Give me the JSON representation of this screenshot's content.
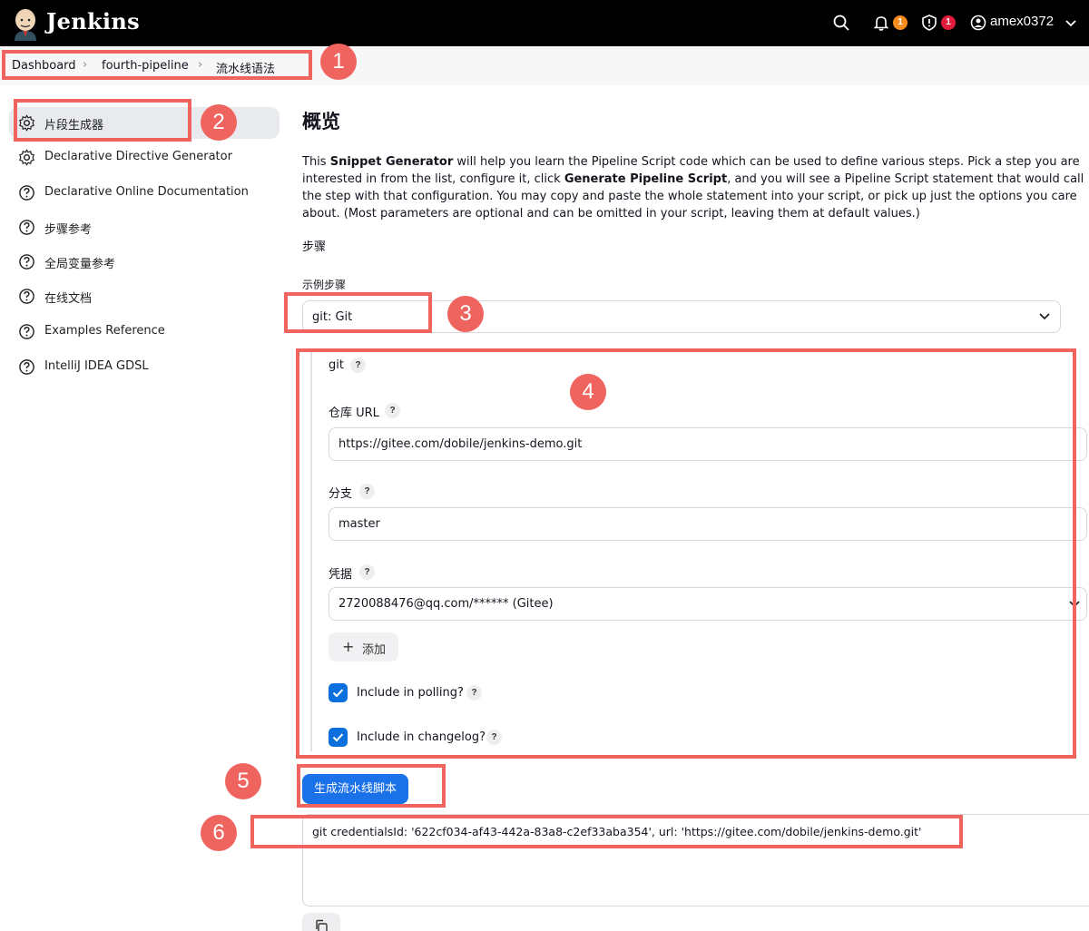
{
  "header": {
    "brand": "Jenkins",
    "notifications_count": "1",
    "security_count": "1",
    "username": "amex0372",
    "colors": {
      "notification_badge": "#f78c1e",
      "security_badge": "#e41c3c"
    }
  },
  "breadcrumb": [
    "Dashboard",
    "fourth-pipeline",
    "流水线语法"
  ],
  "sidebar": {
    "items": [
      {
        "label": "片段生成器",
        "icon": "gear-icon",
        "active": true
      },
      {
        "label": "Declarative Directive Generator",
        "icon": "gear-icon"
      },
      {
        "label": "Declarative Online Documentation",
        "icon": "help-circle-icon"
      },
      {
        "label": "步骤参考",
        "icon": "help-circle-icon"
      },
      {
        "label": "全局变量参考",
        "icon": "help-circle-icon"
      },
      {
        "label": "在线文档",
        "icon": "help-circle-icon"
      },
      {
        "label": "Examples Reference",
        "icon": "help-circle-icon"
      },
      {
        "label": "IntelliJ IDEA GDSL",
        "icon": "help-circle-icon"
      }
    ]
  },
  "main": {
    "title": "概览",
    "description": {
      "p1": "This ",
      "b1": "Snippet Generator",
      "p2": " will help you learn the Pipeline Script code which can be used to define various steps. Pick a step you are interested in from the list, configure it, click ",
      "b2": "Generate Pipeline Script",
      "p3": ", and you will see a Pipeline Script statement that would call the step with that configuration. You may copy and paste the whole statement into your script, or pick up just the options you care about. (Most parameters are optional and can be omitted in your script, leaving them at default values.)"
    },
    "steps_label": "步骤",
    "sample_step_label": "示例步骤",
    "sample_step_value": "git: Git",
    "step_config": {
      "step_name": "git",
      "repo_url_label": "仓库 URL",
      "repo_url_value": "https://gitee.com/dobile/jenkins-demo.git",
      "branch_label": "分支",
      "branch_value": "master",
      "credentials_label": "凭据",
      "credentials_value": "2720088476@qq.com/****** (Gitee)",
      "add_button": "添加",
      "include_polling_label": "Include in polling?",
      "include_polling_checked": true,
      "include_changelog_label": "Include in changelog?",
      "include_changelog_checked": true
    },
    "generate_button": "生成流水线脚本",
    "output_script": "git credentialsId: '622cf034-af43-442a-83a8-c2ef33aba354', url: 'https://gitee.com/dobile/jenkins-demo.git'"
  },
  "annotations": [
    "1",
    "2",
    "3",
    "4",
    "5",
    "6"
  ],
  "help_mark": "?",
  "colors": {
    "primary_button": "#1b72e8",
    "annotation": "#f0645f",
    "checkbox": "#0b6fde"
  }
}
